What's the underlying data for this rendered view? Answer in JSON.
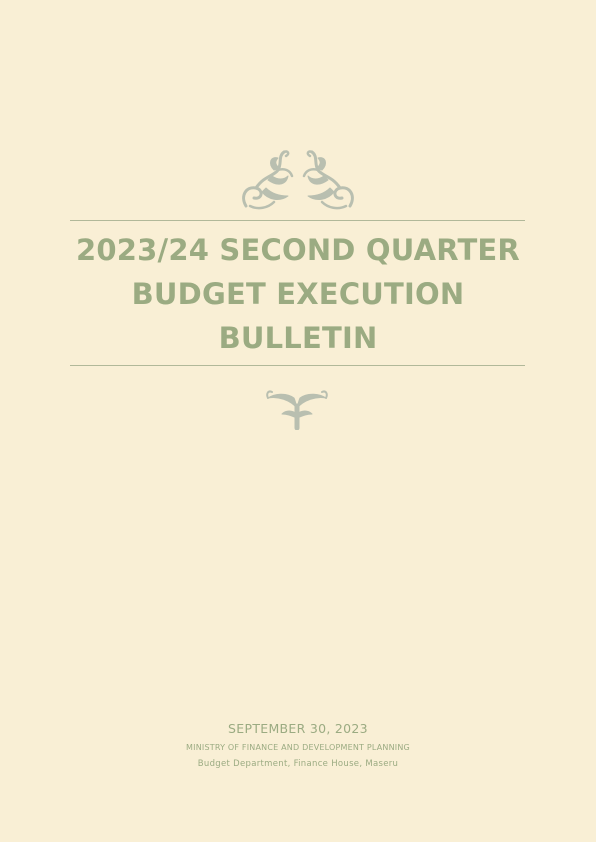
{
  "document": {
    "title_lines": [
      "2023/24 SECOND QUARTER",
      "BUDGET EXECUTION",
      "BULLETIN"
    ],
    "date": "SEPTEMBER 30, 2023",
    "ministry": "MINISTRY OF FINANCE AND DEVELOPMENT PLANNING",
    "address": "Budget Department, Finance House, Maseru"
  },
  "ornaments": {
    "top_icon": "floral-scroll-pair-icon",
    "bottom_icon": "floral-sprig-icon",
    "color": "#b9bfb0"
  },
  "colors": {
    "background": "#f9efd5",
    "text": "#9bab82",
    "rule": "#b1b899"
  }
}
